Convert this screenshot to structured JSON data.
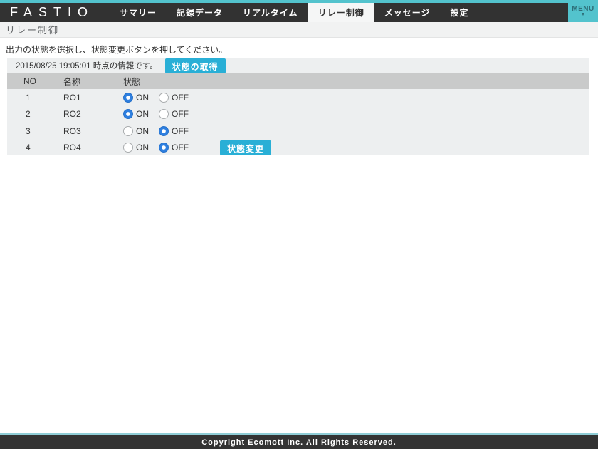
{
  "brand": {
    "logo": "FASTIO",
    "menu_label": "MENU",
    "menu_caret": "▼"
  },
  "nav": {
    "items": [
      {
        "label": "サマリー",
        "active": false
      },
      {
        "label": "記録データ",
        "active": false
      },
      {
        "label": "リアルタイム",
        "active": false
      },
      {
        "label": "リレー制御",
        "active": true
      },
      {
        "label": "メッセージ",
        "active": false
      },
      {
        "label": "設定",
        "active": false
      }
    ]
  },
  "page": {
    "title": "リレー制御",
    "instruction": "出力の状態を選択し、状態変更ボタンを押してください。"
  },
  "panel": {
    "timestamp_note": "2015/08/25 19:05:01 時点の情報です。",
    "fetch_button_label": "状態の取得",
    "change_button_label": "状態変更",
    "table": {
      "headers": [
        "NO",
        "名称",
        "状態"
      ],
      "on_label": "ON",
      "off_label": "OFF",
      "rows": [
        {
          "no": "1",
          "name": "RO1",
          "state": "ON"
        },
        {
          "no": "2",
          "name": "RO2",
          "state": "ON"
        },
        {
          "no": "3",
          "name": "RO3",
          "state": "OFF"
        },
        {
          "no": "4",
          "name": "RO4",
          "state": "OFF"
        }
      ]
    }
  },
  "footer": {
    "copyright": "Copyright Ecomott Inc. All Rights Reserved."
  },
  "colors": {
    "accent_teal": "#53C3CD",
    "button_cyan": "#29AFD6",
    "radio_blue": "#2E7FE0",
    "nav_dark": "#323232",
    "panel_bg": "#EDEFF0",
    "header_row_bg": "#C9CACA"
  }
}
